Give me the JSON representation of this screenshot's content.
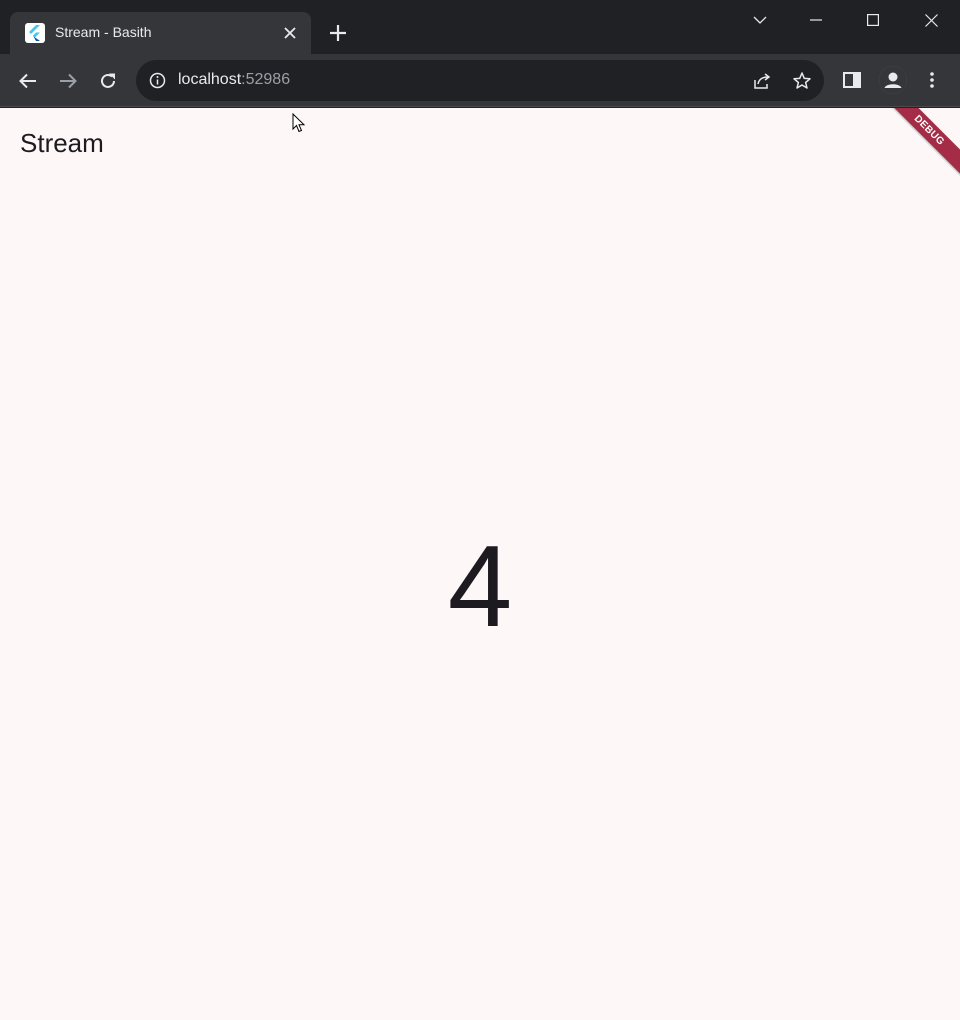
{
  "browser": {
    "tab": {
      "title": "Stream - Basith",
      "favicon": "flutter-logo-icon"
    },
    "address": {
      "host": "localhost",
      "port": ":52986"
    },
    "icons": {
      "back": "arrow-left-icon",
      "forward": "arrow-right-icon",
      "reload": "reload-icon",
      "share": "share-icon",
      "bookmark": "star-icon",
      "side_panel": "side-panel-icon",
      "profile": "profile-icon",
      "menu": "kebab-menu-icon"
    }
  },
  "app": {
    "title": "Stream",
    "counter_value": "4",
    "debug_banner": "DEBUG"
  },
  "colors": {
    "page_background": "#fdf7f8",
    "debug_banner": "#a42c47",
    "text": "#1d1b20"
  }
}
